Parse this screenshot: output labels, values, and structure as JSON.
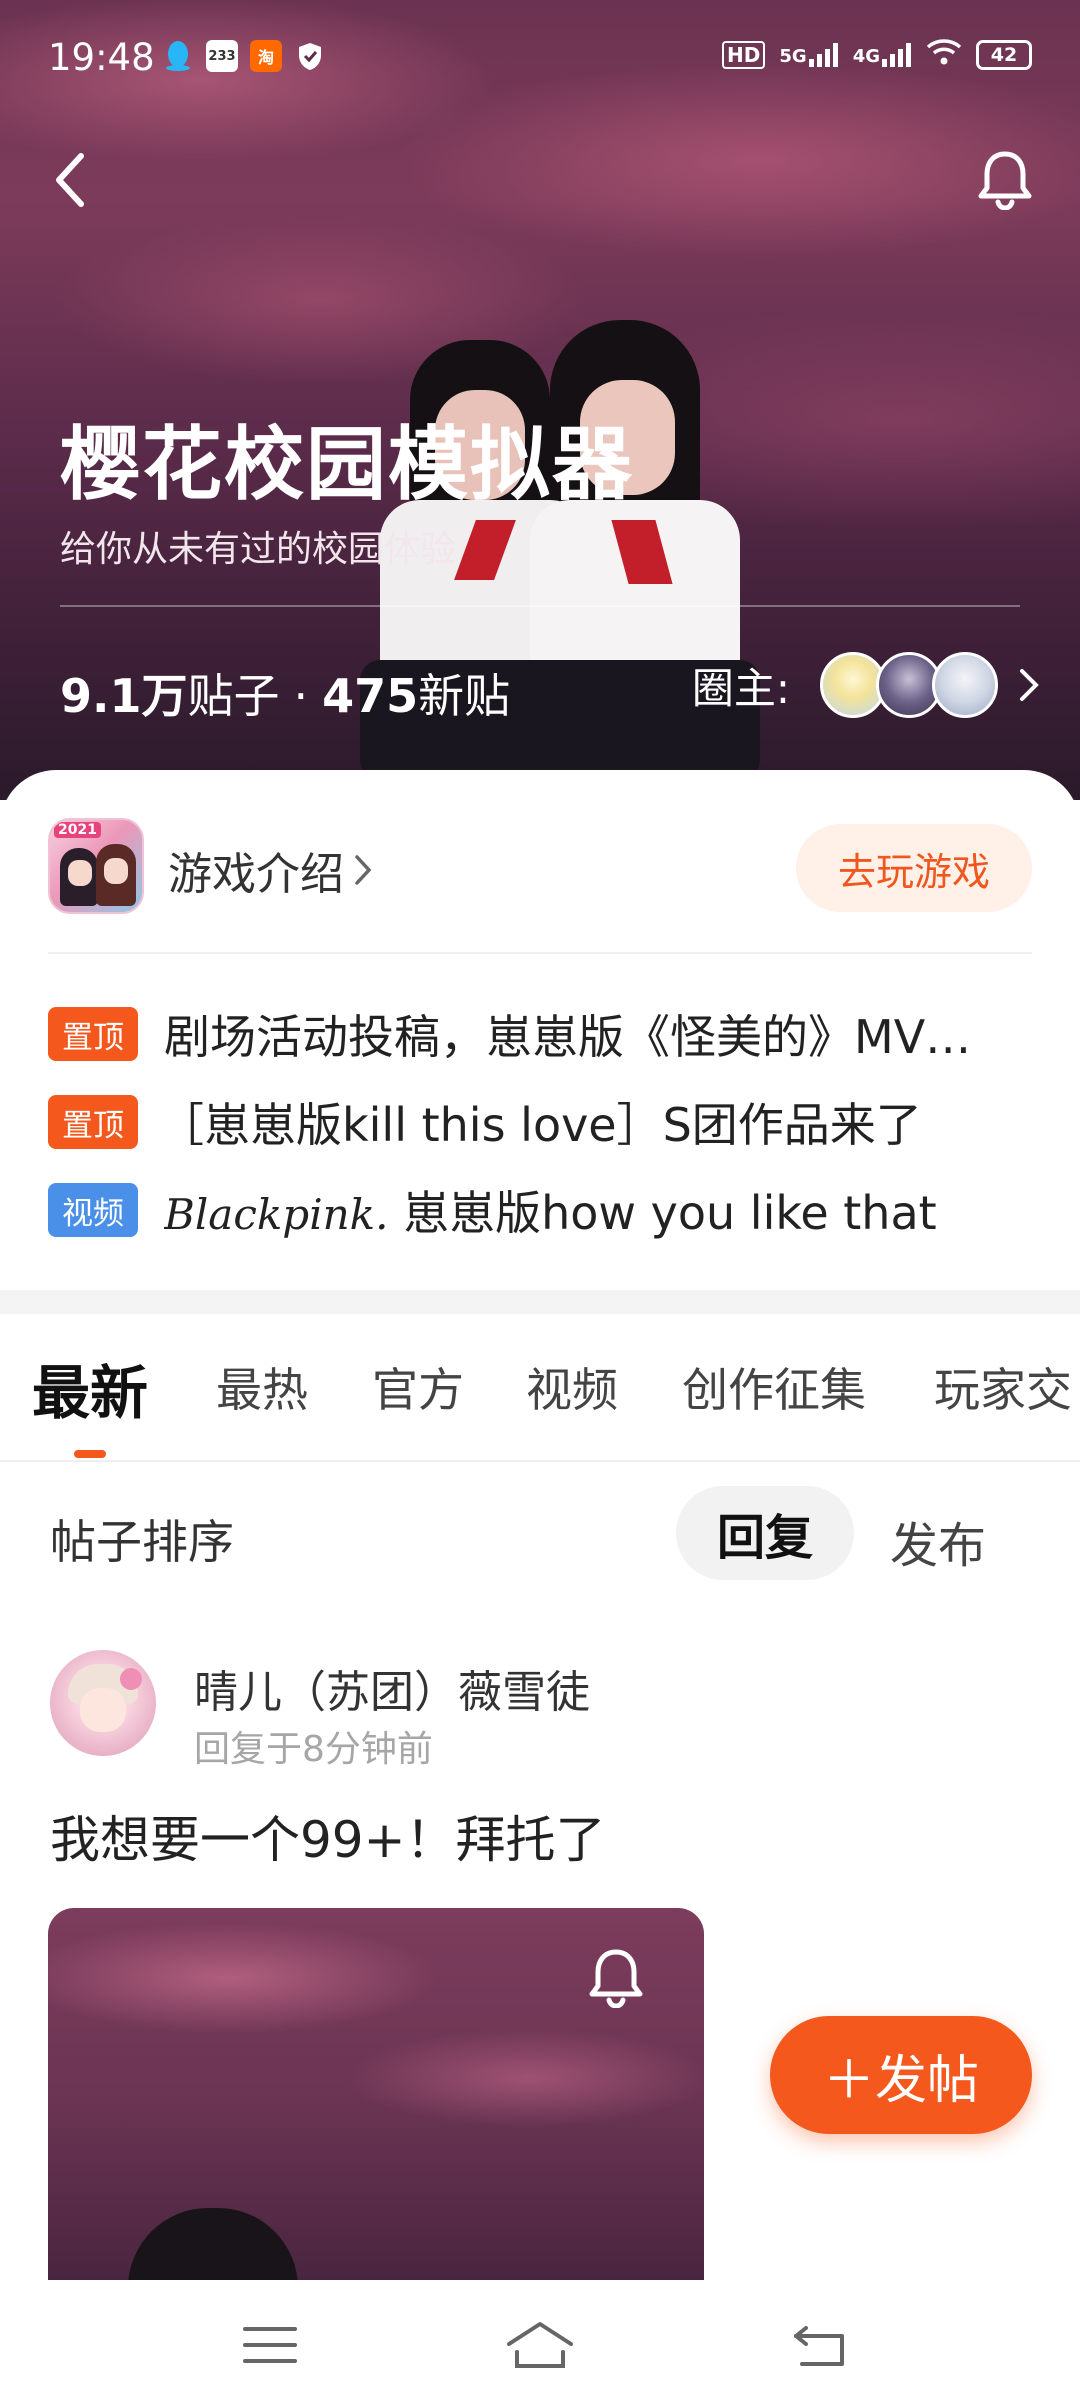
{
  "status_bar": {
    "time": "19:48",
    "icons_left": [
      "qq-icon",
      "app-233-icon",
      "taobao-icon",
      "shield-icon"
    ],
    "app_233_text": "233",
    "signal_hd": "HD",
    "signal_5g": "5G",
    "signal_4g": "4G",
    "battery": "42"
  },
  "header": {
    "title": "樱花校园模拟器",
    "subtitle": "给你从未有过的校园体验",
    "posts_count": "9.1万",
    "posts_label": "贴子",
    "dot": "·",
    "new_count": "475",
    "new_label": "新贴",
    "owners_label": "圈主:"
  },
  "game": {
    "intro_label": "游戏介绍",
    "icon_year": "2021",
    "play_button": "去玩游戏"
  },
  "pinned": [
    {
      "tag": "置顶",
      "tag_color": "#f4581c",
      "text": "剧场活动投稿，崽崽版《怪美的》MV…"
    },
    {
      "tag": "置顶",
      "tag_color": "#f4581c",
      "text": "［崽崽版kill this love］S团作品来了"
    },
    {
      "tag": "视频",
      "tag_color": "#4a90e8",
      "script": "Blackpink.",
      "text": " 崽崽版how you like that"
    }
  ],
  "tabs": [
    "最新",
    "最热",
    "官方",
    "视频",
    "创作征集",
    "玩家交"
  ],
  "sort": {
    "label": "帖子排序",
    "reply": "回复",
    "publish": "发布"
  },
  "post": {
    "username": "晴儿（苏团）薇雪徒",
    "time": "回复于8分钟前",
    "body": "我想要一个99+！拜托了"
  },
  "fab": {
    "label": "＋发帖"
  },
  "colors": {
    "accent": "#f4581c",
    "video_tag": "#4a90e8"
  }
}
